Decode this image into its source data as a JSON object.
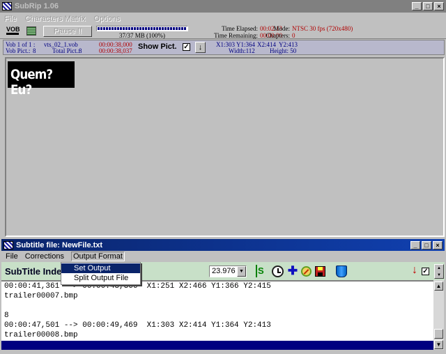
{
  "main_window": {
    "title": "SubRip 1.06",
    "menus": [
      "File",
      "Characters Matrix",
      "Options"
    ]
  },
  "toolbar": {
    "vob_label": "VOB",
    "pause_label": "Pause !!",
    "progress_text": "37/37 MB (100%)",
    "progress_value": 1.0,
    "time_elapsed_label": "Time Elapsed:",
    "time_elapsed_value": "00:02:13",
    "time_remaining_label": "Time Remaining:",
    "time_remaining_value": "00:00:00",
    "mode_label": "Mode:",
    "mode_value": "NTSC 30 fps (720x480)",
    "chapters_label": "Chapters:",
    "chapters_value": "0"
  },
  "info": {
    "vob_label": "Vob 1 of 1 :",
    "vob_file": "vts_02_1.vob",
    "vobpict_label": "Vob Pict.:",
    "vobpict_value": "8",
    "totalpict_label": "Total Pict.:",
    "totalpict_value": "8",
    "time_start": "00:00:38,000",
    "time_end": "00:00:38,037",
    "show_pict_label": "Show Pict.",
    "show_pict_checked": "✓",
    "x1": "X1:303",
    "y1": "Y1:364",
    "x2": "X2:414",
    "y2": "Y2:413",
    "width": "Width:112",
    "height": "Height: 50"
  },
  "preview": {
    "subtitle_text": "Quem? Eu?"
  },
  "subtitle_window": {
    "title": "Subtitle file: NewFile.txt",
    "menus": [
      "File",
      "Corrections",
      "Output Format"
    ],
    "open_menu_items": [
      "Set Output Format",
      "Split Output File"
    ],
    "heading": "SubTitle Index",
    "fps_value": "23.976",
    "lines": [
      "00:00:41,361 --> 00:00:43,366  X1:251 X2:466 Y1:366 Y2:415",
      "trailer00007.bmp",
      "",
      "8",
      "00:00:47,501 --> 00:00:49,469  X1:303 X2:414 Y1:364 Y2:413",
      "trailer00008.bmp"
    ]
  }
}
